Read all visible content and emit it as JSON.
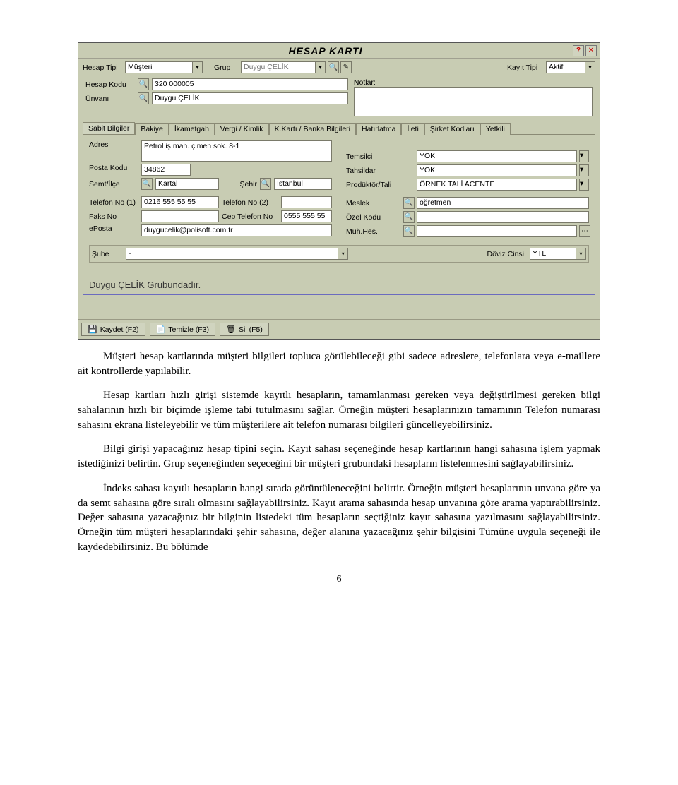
{
  "window": {
    "title": "HESAP  KARTI",
    "help_icon": "?",
    "close_icon": "✕"
  },
  "topbar": {
    "hesap_tipi_label": "Hesap Tipi",
    "hesap_tipi_value": "Müşteri",
    "grup_label": "Grup",
    "grup_value": "Duygu ÇELİK",
    "kayit_tipi_label": "Kayıt Tipi",
    "kayit_tipi_value": "Aktif"
  },
  "header_left": {
    "hesap_kodu_label": "Hesap Kodu",
    "hesap_kodu_value": "320 000005",
    "unvani_label": "Ünvanı",
    "unvani_value": "Duygu ÇELİK"
  },
  "header_right": {
    "notlar_label": "Notlar:"
  },
  "tabs": [
    "Sabit Bilgiler",
    "Bakiye",
    "İkametgah",
    "Vergi / Kimlik",
    "K.Kartı / Banka Bilgileri",
    "Hatırlatma",
    "İleti",
    "Şirket Kodları",
    "Yetkili"
  ],
  "sabit": {
    "adres_label": "Adres",
    "adres_value": "Petrol iş mah. çimen sok. 8-1",
    "posta_label": "Posta Kodu",
    "posta_value": "34862",
    "semt_label": "Semt/İlçe",
    "semt_value": "Kartal",
    "sehir_label": "Şehir",
    "sehir_value": "İstanbul",
    "tel1_label": "Telefon No (1)",
    "tel1_value": "0216 555 55 55",
    "tel2_label": "Telefon No (2)",
    "faks_label": "Faks No",
    "cep_label": "Cep Telefon No",
    "cep_value": "0555 555 55 55",
    "eposta_label": "ePosta",
    "eposta_value": "duygucelik@polisoft.com.tr",
    "temsilci_label": "Temsilci",
    "temsilci_value": "YOK",
    "tahsildar_label": "Tahsildar",
    "tahsildar_value": "YOK",
    "produktor_label": "Prodüktör/Tali",
    "produktor_value": "ÖRNEK TALİ ACENTE",
    "meslek_label": "Meslek",
    "meslek_value": "öğretmen",
    "ozel_label": "Özel Kodu",
    "muhhes_label": "Muh.Hes."
  },
  "sube_line": {
    "sube_label": "Şube",
    "sube_value": "-",
    "doviz_label": "Döviz Cinsi",
    "doviz_value": "YTL"
  },
  "status_text": "Duygu ÇELİK Grubundadır.",
  "footer": {
    "kaydet": "Kaydet (F2)",
    "temizle": "Temizle (F3)",
    "sil": "Sil (F5)"
  },
  "body": {
    "p1": "Müşteri hesap kartlarında müşteri bilgileri topluca görülebileceği gibi sadece adreslere, telefonlara veya e-maillere ait kontrollerde yapılabilir.",
    "p2": "Hesap kartları hızlı girişi sistemde kayıtlı hesapların, tamamlanması gereken veya değiştirilmesi gereken bilgi sahalarının hızlı bir biçimde işleme tabi tutulmasını sağlar. Örneğin müşteri hesaplarınızın tamamının Telefon numarası sahasını ekrana listeleyebilir ve tüm müşterilere ait telefon numarası bilgileri güncelleyebilirsiniz.",
    "p3": "Bilgi girişi yapacağınız hesap tipini seçin. Kayıt sahası seçeneğinde hesap kartlarının hangi sahasına işlem yapmak istediğinizi belirtin. Grup seçeneğinden seçeceğini bir müşteri grubundaki hesapların listelenmesini sağlayabilirsiniz.",
    "p4": "İndeks sahası kayıtlı hesapların hangi sırada görüntüleneceğini belirtir. Örneğin müşteri hesaplarının unvana göre ya da semt sahasına göre sıralı olmasını sağlayabilirsiniz. Kayıt arama sahasında hesap unvanına göre arama yaptırabilirsiniz. Değer sahasına yazacağınız bir bilginin listedeki tüm hesapların seçtiğiniz kayıt sahasına yazılmasını sağlayabilirsiniz. Örneğin tüm müşteri hesaplarındaki şehir sahasına, değer alanına yazacağınız şehir bilgisini Tümüne uygula seçeneği ile kaydedebilirsiniz. Bu bölümde"
  },
  "page_number": "6"
}
